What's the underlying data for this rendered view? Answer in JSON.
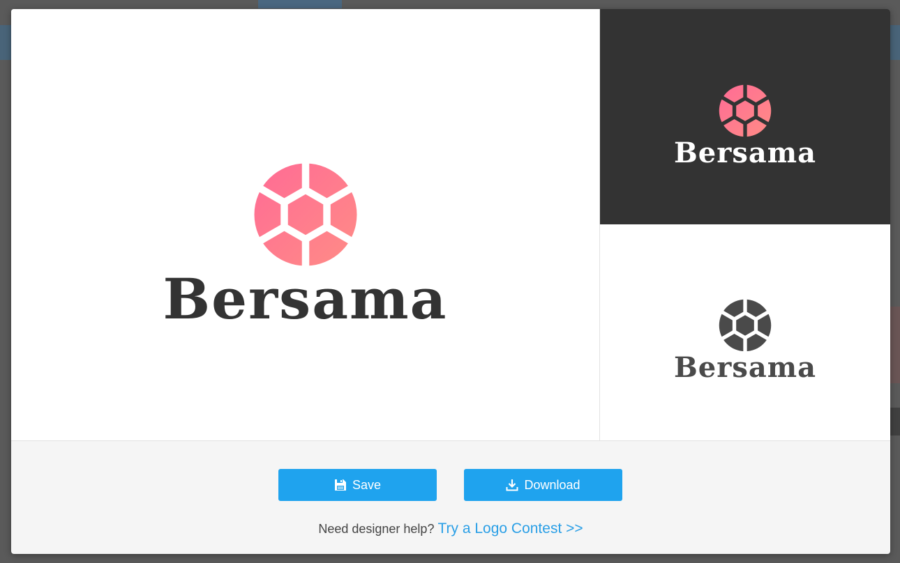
{
  "brand": {
    "name": "Bersama",
    "accent_gradient": [
      "#ff6f91",
      "#ff8b86"
    ],
    "dark_bg": "#333333",
    "text_dark": "#333333",
    "text_mono": "#4a4a4a",
    "button_color": "#1fa3ee",
    "link_color": "#2a9fe6"
  },
  "previews": {
    "main": {
      "logo_text": "Bersama",
      "icon": "hexagon-ball-icon"
    },
    "dark": {
      "logo_text": "Bersama",
      "icon": "hexagon-ball-icon"
    },
    "light": {
      "logo_text": "Bersama",
      "icon": "hexagon-ball-icon"
    }
  },
  "actions": {
    "save_label": "Save",
    "save_icon": "floppy-disk-icon",
    "download_label": "Download",
    "download_icon": "download-tray-icon"
  },
  "help": {
    "prompt": "Need designer help?",
    "link_text": "Try a Logo Contest >>"
  }
}
